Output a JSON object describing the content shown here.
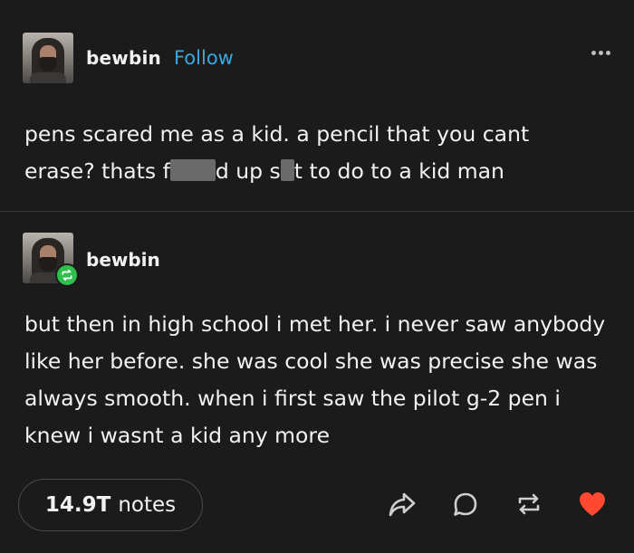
{
  "post": {
    "username": "bewbin",
    "follow_label": "Follow",
    "text_parts": {
      "line1": "pens scared me as a kid. a pencil that you cant",
      "line2_a": "erase? thats f",
      "line2_b": "d up s",
      "line2_c": "t to do to a kid man"
    }
  },
  "reblog": {
    "username": "bewbin",
    "text": "but then in high school i met her. i never saw anybody like her before. she was cool she was precise she was always smooth. when i first saw the pilot g-2 pen i knew i wasnt a kid any more"
  },
  "footer": {
    "notes_count": "14.9T",
    "notes_label": "notes"
  },
  "icons": {
    "more": "more-icon",
    "share": "share-icon",
    "reply": "reply-icon",
    "reblog": "reblog-icon",
    "like": "heart-icon"
  },
  "colors": {
    "background": "#1b1b1b",
    "follow": "#3aa8e0",
    "like": "#ff4930",
    "reblog_badge": "#2fbf4d"
  }
}
